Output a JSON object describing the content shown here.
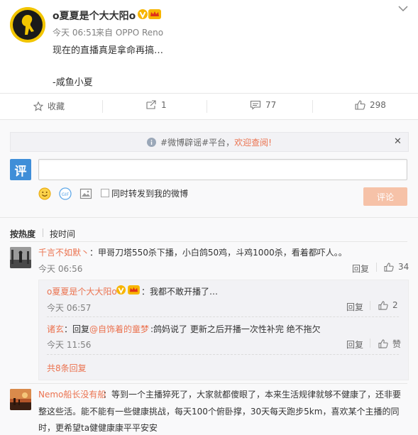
{
  "post": {
    "author": "o夏夏是个大大阳o",
    "time": "今天 06:51",
    "source": "来自 OPPO Reno",
    "text_line1": "现在的直播真是拿命再搞…",
    "text_line2": "-咸鱼小夏"
  },
  "actions": {
    "favorite": "收藏",
    "repost": "1",
    "comment": "77",
    "like": "298"
  },
  "notice": {
    "tags": "#微博辟谣#平台，",
    "welcome": "欢迎查阅!"
  },
  "composer": {
    "logo": "评",
    "repost_label": "同时转发到我的微博",
    "submit": "评论"
  },
  "sort": {
    "hot": "按热度",
    "time": "按时间"
  },
  "comments": [
    {
      "user": "千言不如默丶",
      "text": "：甲哥刀塔550杀下播，小白鸽50鸡，斗鸡1000杀，看着都吓人。。",
      "time": "今天 06:56",
      "reply": "回复",
      "likes": "34"
    },
    {
      "user": "Nemo船长没有船",
      "text_line1": "：等到一个主播猝死了，大家就都傻眼了，本来生活规律就够不健康了，还非要",
      "text_line2": "整这些活。能不能有一些健康挑战，每天100个俯卧撑，30天每天跑步5km，喜欢某个主播的同",
      "text_line3": "时，更希望ta健健康康平平安安"
    }
  ],
  "replies": [
    {
      "user": "o夏夏是个大大阳o",
      "text": "：我都不敢开播了…",
      "time": "今天 06:57",
      "reply": "回复",
      "likes": "2"
    },
    {
      "user": "诸玄",
      "prefix": "：回复",
      "mention": "@自饰着的童梦",
      "text": ":鸽妈说了 更新之后开播一次性补完 绝不拖欠",
      "time": "今天 11:56",
      "reply": "回复",
      "likes": "赞"
    }
  ],
  "more_replies": "共8条回复",
  "colors": {
    "accent": "#eb7350",
    "link": "#3d6bc2",
    "submit_bg": "#f6c2a8"
  }
}
